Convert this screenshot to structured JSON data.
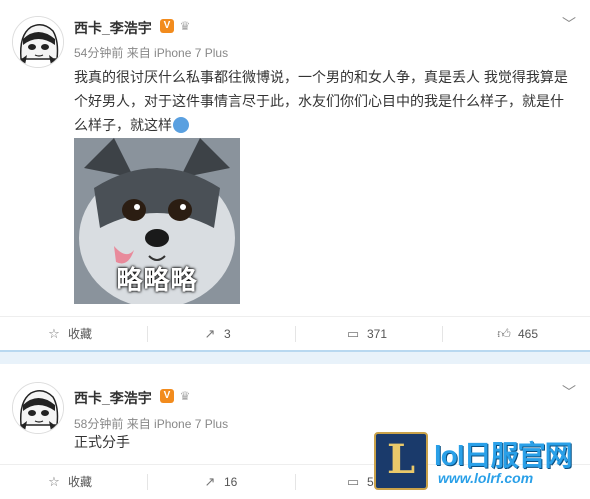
{
  "posts": [
    {
      "author": "西卡_李浩宇",
      "verified_badge": "V",
      "time": "54分钟前",
      "source": "来自 iPhone 7 Plus",
      "text": "我真的很讨厌什么私事都往微博说，一个男的和女人争，真是丢人   我觉得我算是个好男人，对于这件事情言尽于此，水友们你们心目中的我是什么样子，就是什么样子，就这样",
      "image_caption": "略略略",
      "actions": {
        "favorite": "收藏",
        "repost": "3",
        "comment": "371",
        "like": "465"
      }
    },
    {
      "author": "西卡_李浩宇",
      "verified_badge": "V",
      "time": "58分钟前",
      "source": "来自 iPhone 7 Plus",
      "text": "正式分手",
      "actions": {
        "favorite": "收藏",
        "repost": "16",
        "comment": "5"
      }
    }
  ],
  "watermark": {
    "title": "lol日服官网",
    "url": "www.lolrf.com",
    "logo_letter": "L"
  },
  "colors": {
    "separator": "#e8f2fa",
    "badge": "#f28b1d",
    "watermark": "#2aa0e8"
  },
  "icons": [
    "chevron-down-icon",
    "star-icon",
    "repost-icon",
    "comment-icon",
    "thumbs-up-icon",
    "crown-icon",
    "emoji-icon"
  ]
}
